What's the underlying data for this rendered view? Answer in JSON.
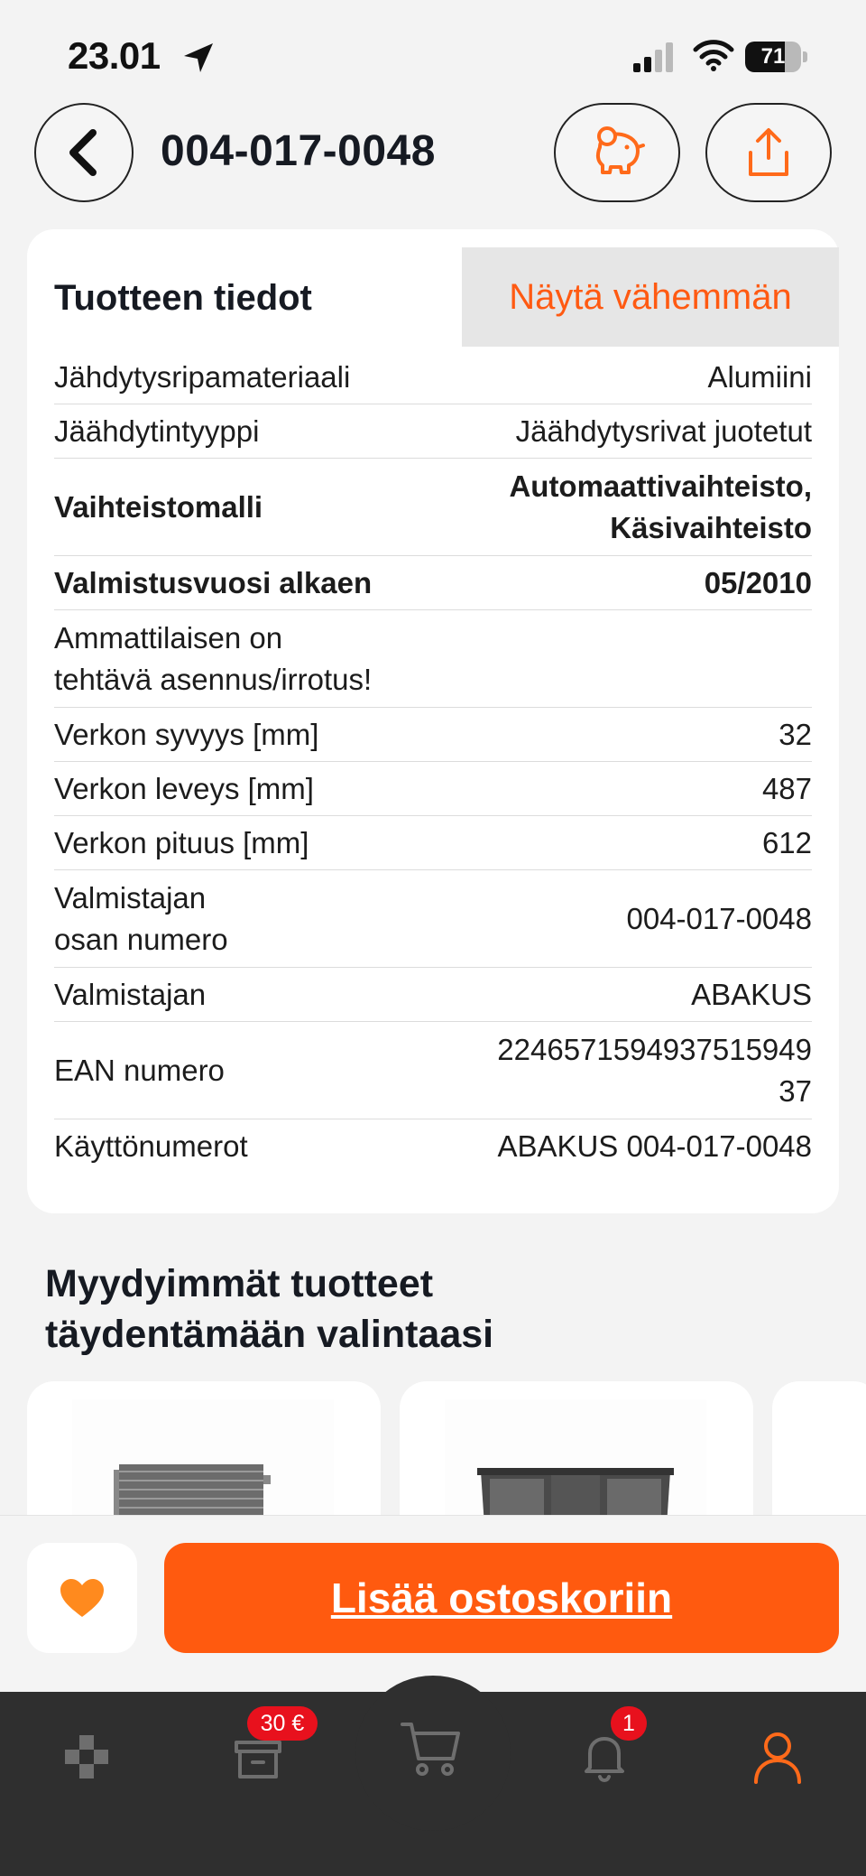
{
  "status_bar": {
    "time": "23.01",
    "battery": "71",
    "battery_level": 0.71
  },
  "header": {
    "title": "004-017-0048"
  },
  "details": {
    "title": "Tuotteen tiedot",
    "toggle_label": "Näytä vähemmän",
    "rows": [
      {
        "label": "Jähdytysripamateriaali",
        "value": "Alumiini",
        "bold": false
      },
      {
        "label": "Jäähdytintyyppi",
        "value": "Jäähdytysrivat juotetut",
        "bold": false
      },
      {
        "label": "Vaihteistomalli",
        "value": "Automaattivaihteisto,\nKäsivaihteisto",
        "bold": true
      },
      {
        "label": "Valmistusvuosi alkaen",
        "value": "05/2010",
        "bold": true
      },
      {
        "label": "Ammattilaisen on\ntehtävä asennus/irrotus!",
        "value": "",
        "bold": false
      },
      {
        "label": "Verkon syvyys [mm]",
        "value": "32",
        "bold": false
      },
      {
        "label": "Verkon leveys [mm]",
        "value": "487",
        "bold": false
      },
      {
        "label": "Verkon pituus [mm]",
        "value": "612",
        "bold": false
      },
      {
        "label": "Valmistajan\nosan numero",
        "value": "004-017-0048",
        "bold": false
      },
      {
        "label": "Valmistajan",
        "value": "ABAKUS",
        "bold": false
      },
      {
        "label": "EAN numero",
        "value": "2246571594937515949\n37",
        "bold": false
      },
      {
        "label": "Käyttönumerot",
        "value": "ABAKUS 004-017-0048",
        "bold": false
      }
    ]
  },
  "bestsellers": {
    "title": "Myydyimmät tuotteet\ntäydentämään valintaasi"
  },
  "action_bar": {
    "add_to_cart": "Lisää ostoskoriin"
  },
  "tab_bar": {
    "coins_badge": "30 €",
    "notifications_badge": "1"
  },
  "colors": {
    "accent": "#ff5a0f",
    "badge": "#e8111d",
    "tab_bar": "#2f2f2f"
  }
}
